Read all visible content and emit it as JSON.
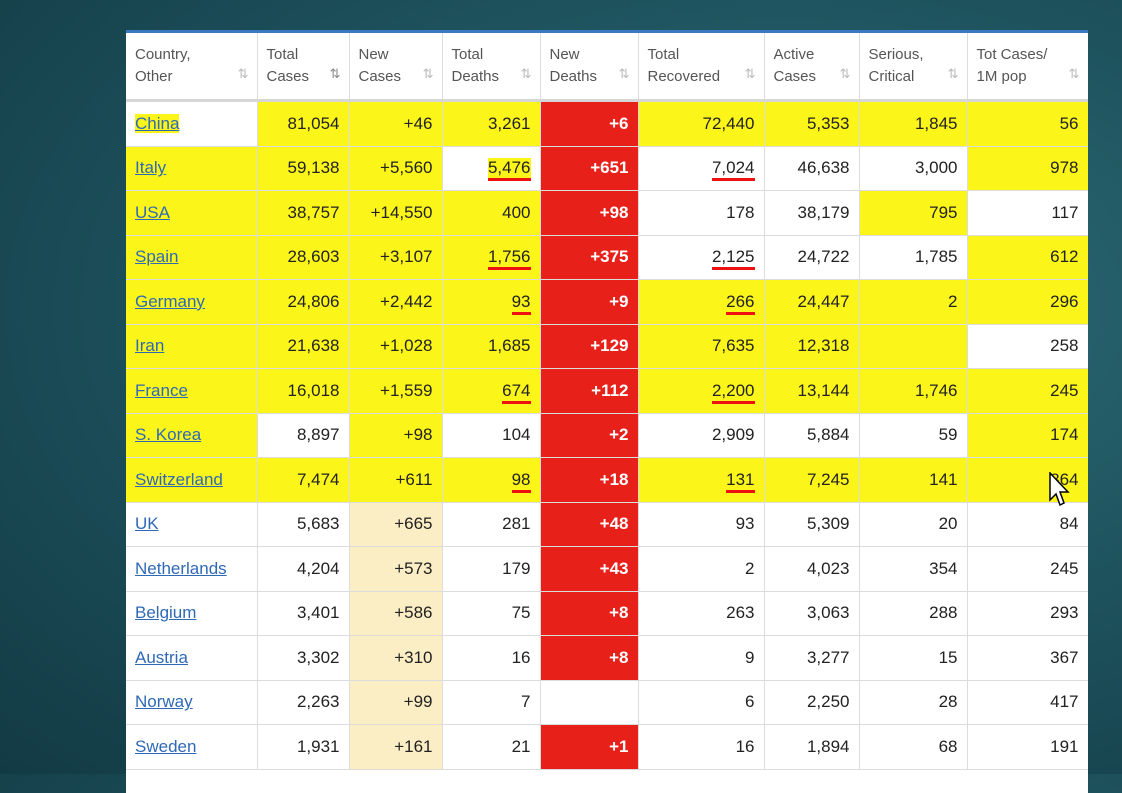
{
  "columns": [
    {
      "line1": "Country,",
      "line2": "Other"
    },
    {
      "line1": "Total",
      "line2": "Cases"
    },
    {
      "line1": "New",
      "line2": "Cases"
    },
    {
      "line1": "Total",
      "line2": "Deaths"
    },
    {
      "line1": "New",
      "line2": "Deaths"
    },
    {
      "line1": "Total",
      "line2": "Recovered"
    },
    {
      "line1": "Active",
      "line2": "Cases"
    },
    {
      "line1": "Serious,",
      "line2": "Critical"
    },
    {
      "line1": "Tot Cases/",
      "line2": "1M pop"
    }
  ],
  "sort_icon": "sort-arrows-icon",
  "colors": {
    "new_deaths_bg": "#e8201a",
    "highlighter": "#fbf51a",
    "link": "#2f69b5",
    "pen": "#e11111"
  },
  "rows": [
    {
      "country": "China",
      "total_cases": "81,054",
      "new_cases": "+46",
      "total_deaths": "3,261",
      "new_deaths": "+6",
      "total_recovered": "72,440",
      "active_cases": "5,353",
      "serious_critical": "1,845",
      "tot_cases_1m": "56"
    },
    {
      "country": "Italy",
      "total_cases": "59,138",
      "new_cases": "+5,560",
      "total_deaths": "5,476",
      "new_deaths": "+651",
      "total_recovered": "7,024",
      "active_cases": "46,638",
      "serious_critical": "3,000",
      "tot_cases_1m": "978"
    },
    {
      "country": "USA",
      "total_cases": "38,757",
      "new_cases": "+14,550",
      "total_deaths": "400",
      "new_deaths": "+98",
      "total_recovered": "178",
      "active_cases": "38,179",
      "serious_critical": "795",
      "tot_cases_1m": "117"
    },
    {
      "country": "Spain",
      "total_cases": "28,603",
      "new_cases": "+3,107",
      "total_deaths": "1,756",
      "new_deaths": "+375",
      "total_recovered": "2,125",
      "active_cases": "24,722",
      "serious_critical": "1,785",
      "tot_cases_1m": "612"
    },
    {
      "country": "Germany",
      "total_cases": "24,806",
      "new_cases": "+2,442",
      "total_deaths": "93",
      "new_deaths": "+9",
      "total_recovered": "266",
      "active_cases": "24,447",
      "serious_critical": "2",
      "tot_cases_1m": "296"
    },
    {
      "country": "Iran",
      "total_cases": "21,638",
      "new_cases": "+1,028",
      "total_deaths": "1,685",
      "new_deaths": "+129",
      "total_recovered": "7,635",
      "active_cases": "12,318",
      "serious_critical": "",
      "tot_cases_1m": "258"
    },
    {
      "country": "France",
      "total_cases": "16,018",
      "new_cases": "+1,559",
      "total_deaths": "674",
      "new_deaths": "+112",
      "total_recovered": "2,200",
      "active_cases": "13,144",
      "serious_critical": "1,746",
      "tot_cases_1m": "245"
    },
    {
      "country": "S. Korea",
      "total_cases": "8,897",
      "new_cases": "+98",
      "total_deaths": "104",
      "new_deaths": "+2",
      "total_recovered": "2,909",
      "active_cases": "5,884",
      "serious_critical": "59",
      "tot_cases_1m": "174"
    },
    {
      "country": "Switzerland",
      "total_cases": "7,474",
      "new_cases": "+611",
      "total_deaths": "98",
      "new_deaths": "+18",
      "total_recovered": "131",
      "active_cases": "7,245",
      "serious_critical": "141",
      "tot_cases_1m": "864"
    },
    {
      "country": "UK",
      "total_cases": "5,683",
      "new_cases": "+665",
      "total_deaths": "281",
      "new_deaths": "+48",
      "total_recovered": "93",
      "active_cases": "5,309",
      "serious_critical": "20",
      "tot_cases_1m": "84"
    },
    {
      "country": "Netherlands",
      "total_cases": "4,204",
      "new_cases": "+573",
      "total_deaths": "179",
      "new_deaths": "+43",
      "total_recovered": "2",
      "active_cases": "4,023",
      "serious_critical": "354",
      "tot_cases_1m": "245"
    },
    {
      "country": "Belgium",
      "total_cases": "3,401",
      "new_cases": "+586",
      "total_deaths": "75",
      "new_deaths": "+8",
      "total_recovered": "263",
      "active_cases": "3,063",
      "serious_critical": "288",
      "tot_cases_1m": "293"
    },
    {
      "country": "Austria",
      "total_cases": "3,302",
      "new_cases": "+310",
      "total_deaths": "16",
      "new_deaths": "+8",
      "total_recovered": "9",
      "active_cases": "3,277",
      "serious_critical": "15",
      "tot_cases_1m": "367"
    },
    {
      "country": "Norway",
      "total_cases": "2,263",
      "new_cases": "+99",
      "total_deaths": "7",
      "new_deaths": "",
      "total_recovered": "6",
      "active_cases": "2,250",
      "serious_critical": "28",
      "tot_cases_1m": "417"
    },
    {
      "country": "Sweden",
      "total_cases": "1,931",
      "new_cases": "+161",
      "total_deaths": "21",
      "new_deaths": "+1",
      "total_recovered": "16",
      "active_cases": "1,894",
      "serious_critical": "68",
      "tot_cases_1m": "191"
    }
  ]
}
